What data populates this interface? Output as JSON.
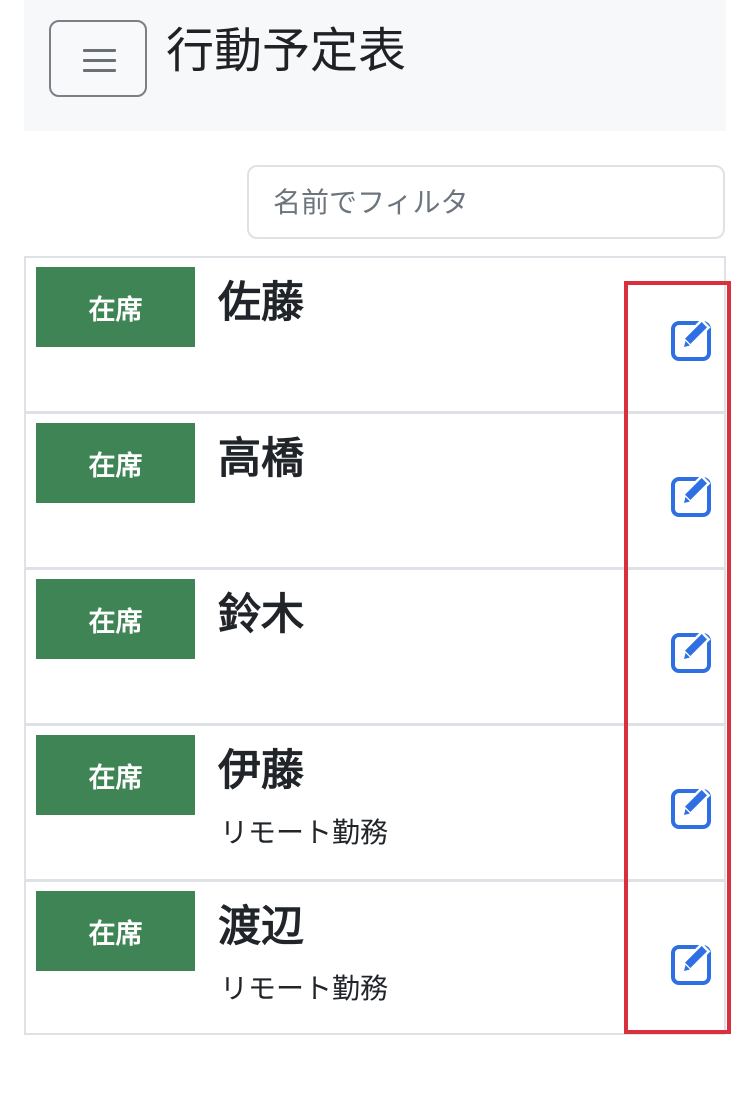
{
  "header": {
    "title": "行動予定表",
    "menu_icon": "hamburger-menu-icon"
  },
  "filter": {
    "placeholder": "名前でフィルタ",
    "value": ""
  },
  "members": [
    {
      "status": "在席",
      "name": "佐藤",
      "note": ""
    },
    {
      "status": "在席",
      "name": "高橋",
      "note": ""
    },
    {
      "status": "在席",
      "name": "鈴木",
      "note": ""
    },
    {
      "status": "在席",
      "name": "伊藤",
      "note": "リモート勤務"
    },
    {
      "status": "在席",
      "name": "渡辺",
      "note": "リモート勤務"
    }
  ],
  "icons": {
    "edit": "edit-pencil-icon"
  },
  "colors": {
    "status_present": "#3e8455",
    "edit_icon": "#2f6fe4",
    "highlight": "#d9303e",
    "navbar_bg": "#f7f8fa",
    "border": "#dee2e6"
  }
}
